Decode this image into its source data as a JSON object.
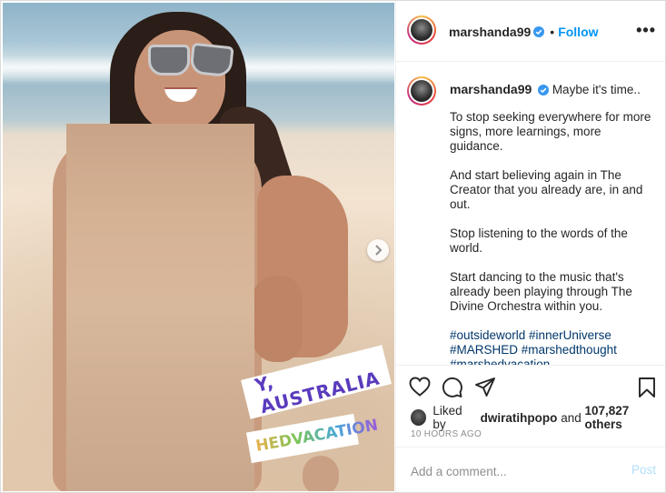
{
  "post": {
    "author": "marshanda99",
    "follow_label": "Follow",
    "separator": "•",
    "more_label": "•••",
    "caption_lines": [
      "Maybe it's time..",
      "To stop seeking everywhere for more signs, more learnings, more guidance.",
      "And start believing again in The Creator that you already are, in and out.",
      "Stop listening to the words of the world.",
      "Start dancing to the music that's already been playing through The Divine Orchestra within you."
    ],
    "hashtags": "#outsideworld #innerUniverse #MARSHED #marshedthought #marshedvacation",
    "likes": {
      "prefix": "Liked by",
      "user": "dwiratihpopo",
      "joiner": "and",
      "others": "107,827 others"
    },
    "time_ago": "10 HOURS AGO",
    "comment": {
      "placeholder": "Add a comment...",
      "post_label": "Post"
    }
  },
  "photo": {
    "sticker_location": "Y, AUSTRALIA",
    "sticker_hashtag": "HEDVACATION"
  },
  "colors": {
    "link_blue": "#0095f6",
    "hashtag_blue": "#00376b",
    "verified_blue": "#3897f0"
  },
  "icons": [
    "verified-badge-icon",
    "more-options-icon",
    "heart-icon",
    "comment-icon",
    "share-icon",
    "bookmark-icon",
    "chevron-right-icon"
  ]
}
